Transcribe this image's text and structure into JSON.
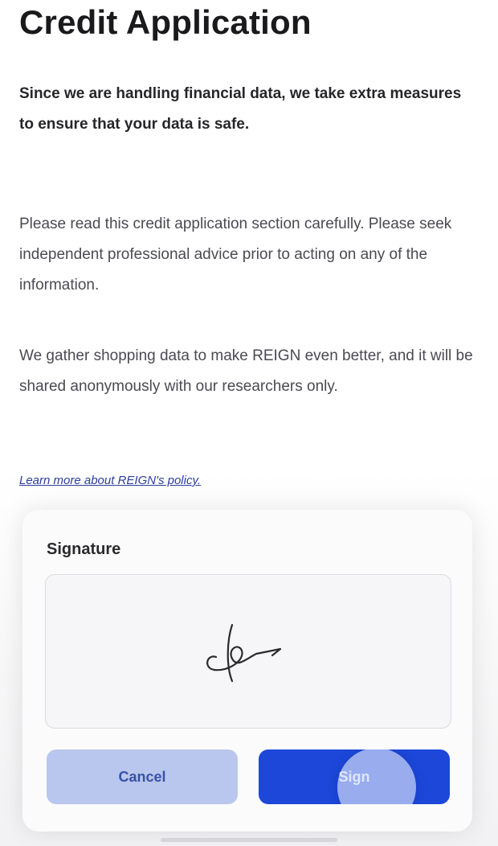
{
  "header": {
    "title": "Credit Application"
  },
  "content": {
    "intro": "Since we are handling financial data, we take extra measures to ensure that your data is safe.",
    "paragraph_1": "Please read this credit application section carefully. Please seek independent professional advice prior to acting on any of the information.",
    "paragraph_2": "We gather shopping data to make REIGN even better, and it will be shared anonymously with our researchers only.",
    "policy_link": "Learn more about REIGN's policy."
  },
  "signature_sheet": {
    "label": "Signature",
    "cancel_label": "Cancel",
    "sign_label": "Sign"
  },
  "colors": {
    "primary": "#1c47d9",
    "cancel_bg": "#b9c7ee",
    "link": "#2d3e9c"
  }
}
